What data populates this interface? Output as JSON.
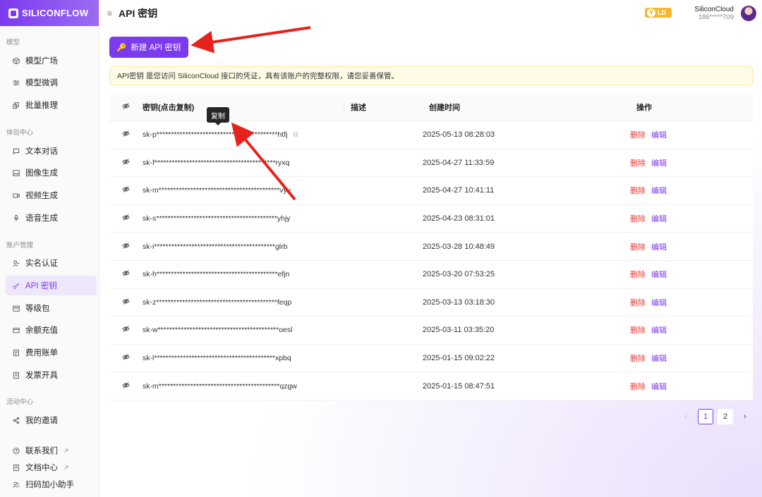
{
  "brand": {
    "logo_text": "SILICONFLOW"
  },
  "header": {
    "title": "API 密钥",
    "level": "LD",
    "user_name": "SiliconCloud",
    "user_phone": "186*****709"
  },
  "sidebar": {
    "sections": {
      "models": "模型",
      "experience": "体验中心",
      "account": "账户管理",
      "activity": "活动中心"
    },
    "items": {
      "model_plaza": "模型广场",
      "model_finetune": "模型微调",
      "batch_inference": "批量推理",
      "text_chat": "文本对话",
      "image_gen": "图像生成",
      "video_gen": "视频生成",
      "voice_gen": "语音生成",
      "real_name": "实名认证",
      "api_key": "API 密钥",
      "level_pack": "等级包",
      "balance": "余额充值",
      "billing": "费用账单",
      "invoice": "发票开具",
      "my_invite": "我的邀请",
      "contact": "联系我们",
      "docs": "文档中心",
      "scan": "扫码加小助手"
    }
  },
  "main": {
    "new_button": "新建 API 密钥",
    "notice": "API密钥 是您访问 SiliconCloud 接口的凭证，具有该账户的完整权限，请您妥善保管。",
    "tooltip": "复制",
    "table": {
      "headers": {
        "key": "密钥(点击复制)",
        "desc": "描述",
        "created": "创建时间",
        "op": "操作"
      },
      "delete_label": "删除",
      "edit_label": "编辑",
      "rows": [
        {
          "key": "sk-p******************************************htfj",
          "desc": "",
          "created": "2025-05-13 08:28:03"
        },
        {
          "key": "sk-f******************************************ryxq",
          "desc": "",
          "created": "2025-04-27 11:33:59"
        },
        {
          "key": "sk-m******************************************vyv",
          "desc": "",
          "created": "2025-04-27 10:41:11"
        },
        {
          "key": "sk-s******************************************yhjy",
          "desc": "",
          "created": "2025-04-23 08:31:01"
        },
        {
          "key": "sk-i******************************************glrb",
          "desc": "",
          "created": "2025-03-28 10:48:49"
        },
        {
          "key": "sk-h******************************************efjn",
          "desc": "",
          "created": "2025-03-20 07:53:25"
        },
        {
          "key": "sk-z******************************************feqp",
          "desc": "",
          "created": "2025-03-13 03:18:30"
        },
        {
          "key": "sk-w******************************************oesl",
          "desc": "",
          "created": "2025-03-11 03:35:20"
        },
        {
          "key": "sk-l******************************************xpbq",
          "desc": "",
          "created": "2025-01-15 09:02:22"
        },
        {
          "key": "sk-m******************************************qzgw",
          "desc": "",
          "created": "2025-01-15 08:47:51"
        }
      ]
    },
    "pagination": {
      "prev": "‹",
      "pages": [
        "1",
        "2"
      ],
      "next": "›",
      "current": "1"
    }
  },
  "colors": {
    "accent": "#7c3aed",
    "delete": "#e53935",
    "notice_bg": "#fffbe6",
    "annotation_arrow": "#e8211b"
  }
}
